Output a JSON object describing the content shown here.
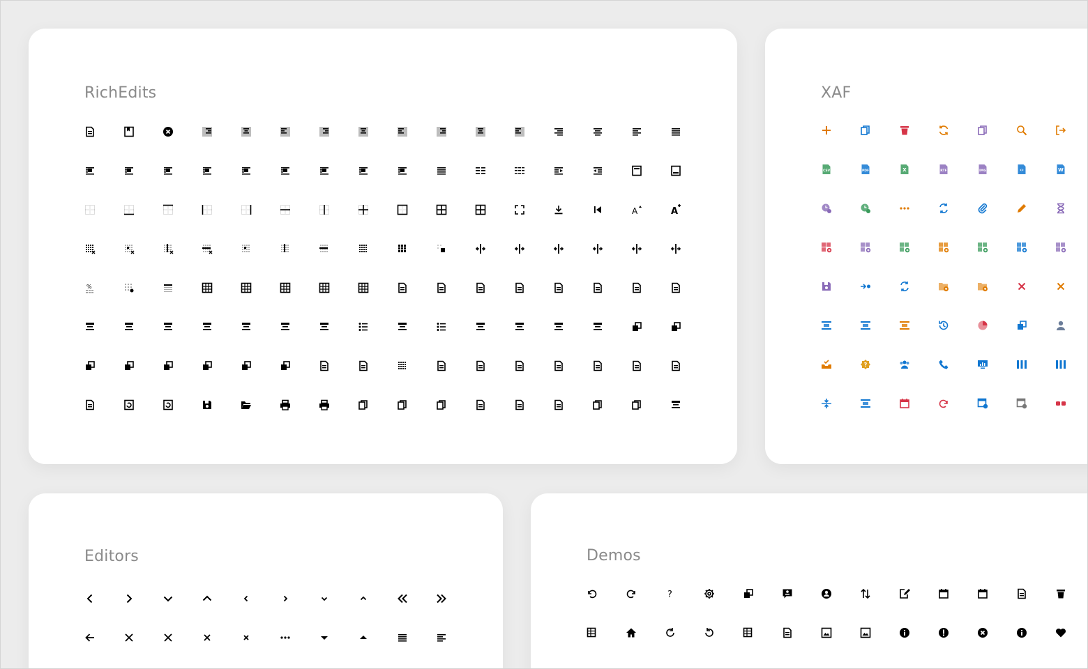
{
  "cards": {
    "richedits": {
      "title": "RichEdits",
      "color": "#000000"
    },
    "xaf": {
      "title": "XAF"
    },
    "editors": {
      "title": "Editors",
      "color": "#000000"
    },
    "demos": {
      "title": "Demos",
      "color": "#000000"
    }
  },
  "richedits_icons": [
    [
      "doc-properties",
      "bookmark",
      "close-circle",
      "align-right-shaded",
      "align-center-shaded",
      "align-left-shaded",
      "align-right-shaded",
      "align-center-shaded",
      "align-left-shaded",
      "align-right-shaded",
      "align-center-shaded",
      "align-left-shaded",
      "align-right",
      "align-center",
      "align-left",
      "align-justify"
    ],
    [
      "wrap-square",
      "wrap-tight",
      "wrap-through",
      "wrap-top-bottom",
      "wrap-behind",
      "wrap-in-front",
      "wrap-left",
      "wrap-right",
      "wrap-both",
      "lines",
      "list-two-col",
      "list-three-col",
      "indent-increase",
      "indent-decrease",
      "header",
      "footer"
    ],
    [
      "table-borders-none",
      "border-bottom",
      "border-top",
      "border-left",
      "border-right",
      "border-inside-h",
      "border-inside-v",
      "border-inside",
      "border-outside",
      "border-all",
      "border-all-thick",
      "fullscreen",
      "download",
      "first-page",
      "font-grow",
      "font-shrink"
    ],
    [
      "delete-table",
      "delete-cell",
      "delete-column",
      "delete-row",
      "select-cell",
      "select-column",
      "select-row",
      "select-table",
      "table-grid",
      "merge-cells",
      "split-v",
      "split-v-right",
      "split-h",
      "split-h-mid",
      "insert-row-above",
      "insert-row-below"
    ],
    [
      "table-percent",
      "table-settings",
      "table-header",
      "table",
      "table",
      "table-cols",
      "table",
      "table",
      "doc-insert",
      "doc-forward",
      "doc-send",
      "doc-back",
      "doc-link",
      "doc-frame",
      "doc-list",
      "doc-search"
    ],
    [
      "text-center-box",
      "text-center-box",
      "text-left-box",
      "text-right-box",
      "text-box",
      "text-right-box",
      "text-under",
      "list-bullets",
      "list-nested",
      "list-numbers",
      "field-plus",
      "field-code",
      "field-label",
      "dotted-grid",
      "bring-front",
      "send-back"
    ],
    [
      "bring-forward",
      "shape-text",
      "send-backward",
      "group",
      "ungroup",
      "layer-front",
      "doc-in",
      "doc-corner",
      "select-dotted",
      "list-box",
      "list-frame",
      "doc-lines",
      "insert-break",
      "page",
      "page-alt",
      "shapes"
    ],
    [
      "page-blank",
      "refresh-page",
      "refresh-page",
      "save",
      "folder-open",
      "print",
      "print-preview",
      "copy",
      "paste-in",
      "clipboard",
      "page-break",
      "page-break-alt",
      "page-break-alt",
      "copy-check",
      "copy-check-filled",
      "text-frame"
    ]
  ],
  "xaf_icons": [
    [
      {
        "n": "plus",
        "c": "#e07b00"
      },
      {
        "n": "copy-blue",
        "c": "#1177d1"
      },
      {
        "n": "trash",
        "c": "#d63447"
      },
      {
        "n": "refresh",
        "c": "#e07b00"
      },
      {
        "n": "clipboard-search",
        "c": "#8a6bb8"
      },
      {
        "n": "search",
        "c": "#e07b00"
      },
      {
        "n": "sign-out",
        "c": "#e07b00"
      }
    ],
    [
      {
        "n": "file-csv",
        "c": "#3a9b5c"
      },
      {
        "n": "file-pdf",
        "c": "#1177d1"
      },
      {
        "n": "file-xls",
        "c": "#3a9b5c"
      },
      {
        "n": "file-rtf",
        "c": "#8a6bb8"
      },
      {
        "n": "file-img",
        "c": "#8a6bb8"
      },
      {
        "n": "file-code",
        "c": "#1177d1"
      },
      {
        "n": "file-word",
        "c": "#1177d1"
      }
    ],
    [
      {
        "n": "clock-filter",
        "c": "#8a6bb8"
      },
      {
        "n": "check-clock",
        "c": "#3a9b5c"
      },
      {
        "n": "ellipsis",
        "c": "#e07b00"
      },
      {
        "n": "link-refresh",
        "c": "#1177d1"
      },
      {
        "n": "paperclip",
        "c": "#1177d1"
      },
      {
        "n": "pencil",
        "c": "#e07b00"
      },
      {
        "n": "hourglass",
        "c": "#8a6bb8"
      }
    ],
    [
      {
        "n": "grid-delete",
        "c": "#d63447"
      },
      {
        "n": "grid-settings",
        "c": "#8a6bb8"
      },
      {
        "n": "grid-add",
        "c": "#3a9b5c"
      },
      {
        "n": "grid-gear",
        "c": "#e07b00"
      },
      {
        "n": "grid-add-alt",
        "c": "#3a9b5c"
      },
      {
        "n": "grid-edit",
        "c": "#1177d1"
      },
      {
        "n": "grid-view",
        "c": "#8a6bb8"
      }
    ],
    [
      {
        "n": "save",
        "c": "#8a6bb8"
      },
      {
        "n": "arrow-dot",
        "c": "#1177d1"
      },
      {
        "n": "swap",
        "c": "#1177d1"
      },
      {
        "n": "folder-x",
        "c": "#e07b00"
      },
      {
        "n": "folder-plus",
        "c": "#e07b00"
      },
      {
        "n": "close-red",
        "c": "#d63447"
      },
      {
        "n": "close-orange",
        "c": "#e07b00"
      }
    ],
    [
      {
        "n": "align-center-top",
        "c": "#1177d1"
      },
      {
        "n": "list-center",
        "c": "#1177d1"
      },
      {
        "n": "filter-list",
        "c": "#e07b00"
      },
      {
        "n": "history",
        "c": "#1177d1"
      },
      {
        "n": "pie-chart",
        "c": "#d63447"
      },
      {
        "n": "group-objects",
        "c": "#1177d1"
      },
      {
        "n": "user",
        "c": "#6b7d99"
      }
    ],
    [
      {
        "n": "inbox-check",
        "c": "#e07b00"
      },
      {
        "n": "badge-question",
        "c": "#e0a020"
      },
      {
        "n": "team",
        "c": "#1177d1"
      },
      {
        "n": "phone",
        "c": "#1177d1"
      },
      {
        "n": "monitor-chart",
        "c": "#1177d1"
      },
      {
        "n": "columns",
        "c": "#1177d1"
      },
      {
        "n": "columns-alt",
        "c": "#1177d1"
      }
    ],
    [
      {
        "n": "collapse-v",
        "c": "#1177d1"
      },
      {
        "n": "list-lock",
        "c": "#1177d1"
      },
      {
        "n": "calendar",
        "c": "#d63447"
      },
      {
        "n": "redo",
        "c": "#d63447"
      },
      {
        "n": "settings-window",
        "c": "#1177d1"
      },
      {
        "n": "window-x",
        "c": "#777777"
      },
      {
        "n": "link-broken",
        "c": "#d63447"
      }
    ]
  ],
  "editors_icons": [
    [
      "chevron-left",
      "chevron-right",
      "chevron-down",
      "chevron-up",
      "chevron-left-small",
      "chevron-right-small",
      "chevron-down-small",
      "chevron-up-small",
      "double-left",
      "double-right"
    ],
    [
      "arrow-left",
      "close",
      "close",
      "close-small",
      "close-smaller",
      "more-horizontal",
      "caret-down",
      "caret-up",
      "menu",
      "menu-left"
    ]
  ],
  "demos_icons": [
    [
      "undo",
      "redo",
      "question",
      "gear",
      "layers",
      "comment-user",
      "user-circle",
      "sort-arrows",
      "edit-square",
      "calendar-small",
      "calendar-grid",
      "doc-lines",
      "trash-bin"
    ],
    [
      "table-filter",
      "home",
      "rotate-left",
      "rotate-right",
      "table-small",
      "doc-table",
      "image-frame",
      "image-frame-alt",
      "info-filled",
      "exclamation-filled",
      "close-filled",
      "info-filled-alt",
      "heart"
    ]
  ]
}
